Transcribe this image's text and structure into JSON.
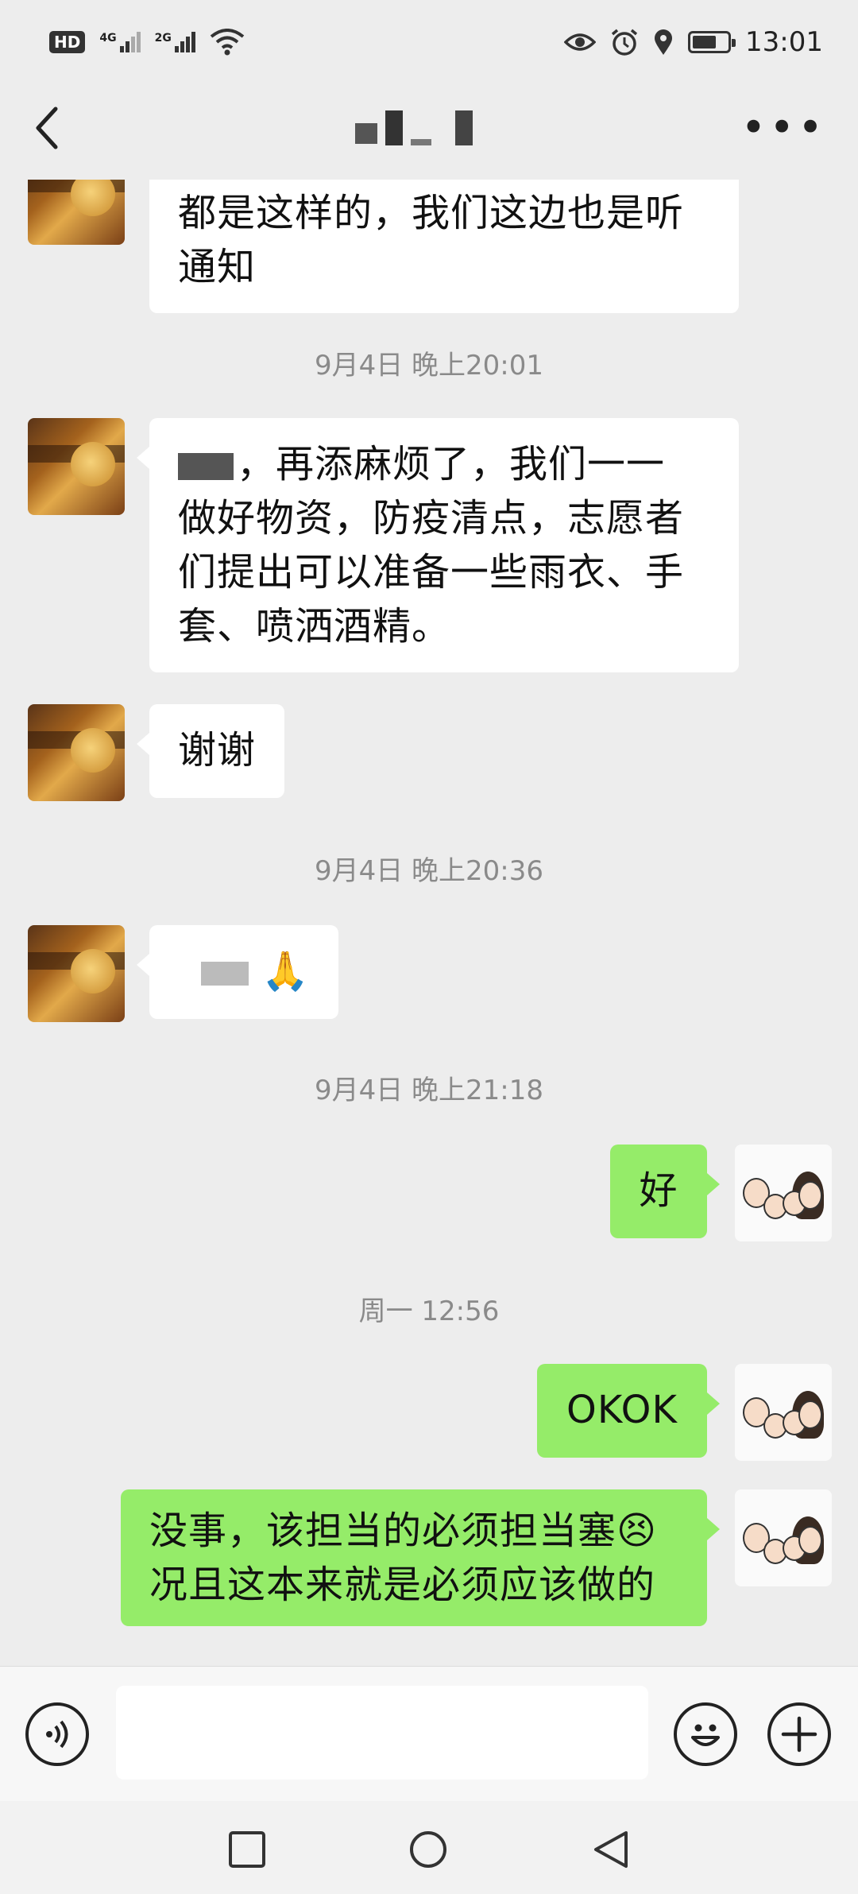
{
  "status_bar": {
    "left_badge": "HD",
    "sim1_label": "4G",
    "sim2_label": "2G",
    "icons": [
      "hd-icon",
      "signal-4g-icon",
      "signal-2g-icon",
      "wifi-icon"
    ],
    "right_icons": [
      "eye-icon",
      "alarm-icon",
      "location-icon",
      "battery-icon"
    ],
    "time": "13:01"
  },
  "nav": {
    "title": "",
    "back_icon": "chevron-left-icon",
    "more_icon": "more-dots-icon",
    "more_glyph": "•••"
  },
  "messages": [
    {
      "side": "left",
      "text_lines": [
        "都是这样的，我们这边也是听",
        "通知"
      ]
    },
    {
      "type": "timestamp",
      "text": "9月4日 晚上20:01"
    },
    {
      "side": "left",
      "text_lines": [
        "，再添麻烦了，我们一一",
        "做好物资，防疫清点，志愿者",
        "们提出可以准备一些雨衣、手",
        "套、喷洒酒精。"
      ]
    },
    {
      "side": "left",
      "text_lines": [
        "谢谢"
      ]
    },
    {
      "type": "timestamp",
      "text": "9月4日 晚上20:36"
    },
    {
      "side": "left",
      "text_lines": [
        "🙏"
      ]
    },
    {
      "type": "timestamp",
      "text": "9月4日 晚上21:18"
    },
    {
      "side": "right",
      "text_lines": [
        "好"
      ]
    },
    {
      "type": "timestamp",
      "text": "周一 12:56"
    },
    {
      "side": "right",
      "text_lines": [
        "OKOK"
      ]
    },
    {
      "side": "right",
      "text_lines": [
        "没事，该担当的必须担当塞😣",
        "况且这本来就是必须应该做的"
      ]
    }
  ],
  "input_bar": {
    "voice_icon": "voice-icon",
    "voice_glyph": "🔊",
    "input_value": "",
    "emoji_icon": "emoji-icon",
    "emoji_glyph": "☺",
    "plus_icon": "plus-icon",
    "plus_glyph": "+"
  },
  "system_nav": [
    "recent-apps-icon",
    "home-icon",
    "back-icon"
  ],
  "colors": {
    "background": "#ededed",
    "bubble_left": "#ffffff",
    "bubble_right": "#95ec69",
    "timestamp": "#8a8a8a"
  }
}
